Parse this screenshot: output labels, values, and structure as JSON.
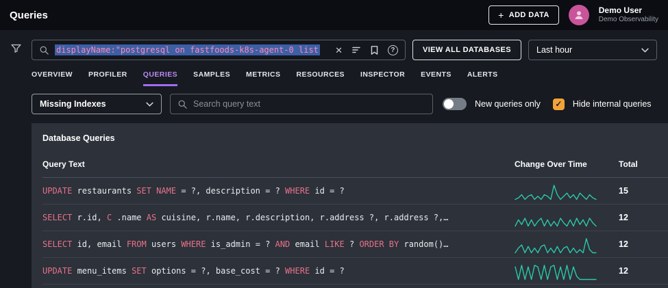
{
  "header": {
    "title": "Queries",
    "add_data_label": "ADD DATA",
    "user_name": "Demo User",
    "user_org": "Demo Observability"
  },
  "icons": {
    "plus": "+",
    "close": "✕",
    "help": "?",
    "check": "✓"
  },
  "searchbar": {
    "query": "displayName:\"postgresql on fastfoods-k8s-agent-0 list",
    "view_all_label": "VIEW ALL DATABASES",
    "time_range": "Last hour"
  },
  "tabs": [
    {
      "label": "OVERVIEW",
      "active": false
    },
    {
      "label": "PROFILER",
      "active": false
    },
    {
      "label": "QUERIES",
      "active": true
    },
    {
      "label": "SAMPLES",
      "active": false
    },
    {
      "label": "METRICS",
      "active": false
    },
    {
      "label": "RESOURCES",
      "active": false
    },
    {
      "label": "INSPECTOR",
      "active": false
    },
    {
      "label": "EVENTS",
      "active": false
    },
    {
      "label": "ALERTS",
      "active": false
    }
  ],
  "filters": {
    "index_filter": "Missing Indexes",
    "search_placeholder": "Search query text",
    "new_queries_label": "New queries only",
    "new_queries_on": false,
    "hide_internal_label": "Hide internal queries",
    "hide_internal_checked": true
  },
  "panel": {
    "title": "Database Queries",
    "columns": [
      "Query Text",
      "Change Over Time",
      "Total"
    ],
    "rows": [
      {
        "segments": [
          {
            "t": "kw",
            "s": "UPDATE "
          },
          {
            "t": "id",
            "s": "restaurants "
          },
          {
            "t": "kw",
            "s": "SET NAME "
          },
          {
            "t": "id",
            "s": "= ?, description = ? "
          },
          {
            "t": "kw",
            "s": "WHERE "
          },
          {
            "t": "id",
            "s": "id = ?"
          }
        ],
        "total": "15",
        "sparkline": [
          0,
          1,
          3,
          0,
          2,
          3,
          0,
          2,
          0,
          3,
          2,
          0,
          9,
          3,
          0,
          2,
          4,
          1,
          3,
          0,
          4,
          2,
          0,
          3,
          1,
          0
        ]
      },
      {
        "segments": [
          {
            "t": "kw",
            "s": "SELECT "
          },
          {
            "t": "id",
            "s": "r.id, "
          },
          {
            "t": "kw",
            "s": "C "
          },
          {
            "t": "id",
            "s": ".name "
          },
          {
            "t": "kw",
            "s": "AS "
          },
          {
            "t": "id",
            "s": "cuisine, r.name, r.description, r.address ?, r.address ?,…"
          }
        ],
        "total": "12",
        "sparkline": [
          0,
          4,
          1,
          5,
          0,
          4,
          0,
          3,
          5,
          0,
          4,
          0,
          3,
          0,
          5,
          2,
          0,
          4,
          0,
          5,
          1,
          4,
          0,
          5,
          2,
          0
        ]
      },
      {
        "segments": [
          {
            "t": "kw",
            "s": "SELECT "
          },
          {
            "t": "id",
            "s": "id, email "
          },
          {
            "t": "kw",
            "s": "FROM "
          },
          {
            "t": "id",
            "s": "users "
          },
          {
            "t": "kw",
            "s": "WHERE "
          },
          {
            "t": "id",
            "s": "is_admin = ? "
          },
          {
            "t": "kw",
            "s": "AND "
          },
          {
            "t": "id",
            "s": "email "
          },
          {
            "t": "kw",
            "s": "LIKE "
          },
          {
            "t": "id",
            "s": "? "
          },
          {
            "t": "kw",
            "s": "ORDER BY "
          },
          {
            "t": "id",
            "s": "random()…"
          }
        ],
        "total": "12",
        "sparkline": [
          0,
          3,
          5,
          0,
          4,
          0,
          3,
          0,
          4,
          5,
          0,
          3,
          0,
          4,
          0,
          3,
          4,
          0,
          3,
          0,
          2,
          0,
          9,
          2,
          0,
          0
        ]
      },
      {
        "segments": [
          {
            "t": "kw",
            "s": "UPDATE "
          },
          {
            "t": "id",
            "s": "menu_items "
          },
          {
            "t": "kw",
            "s": "SET "
          },
          {
            "t": "id",
            "s": "options = ?, base_cost = ? "
          },
          {
            "t": "kw",
            "s": "WHERE "
          },
          {
            "t": "id",
            "s": "id = ?"
          }
        ],
        "total": "12",
        "sparkline": [
          8,
          0,
          9,
          0,
          8,
          0,
          9,
          8,
          0,
          9,
          0,
          8,
          9,
          0,
          8,
          0,
          9,
          0,
          8,
          2,
          0,
          0,
          0,
          0,
          0,
          0
        ]
      }
    ]
  },
  "colors": {
    "accent_purple": "#b989f5",
    "sparkline_teal": "#2cc8a9",
    "checkbox_orange": "#f3a238",
    "sql_keyword_pink": "#e87288",
    "selection_blue": "#3c5fa6",
    "selection_text_pink": "#ff8ab5"
  }
}
